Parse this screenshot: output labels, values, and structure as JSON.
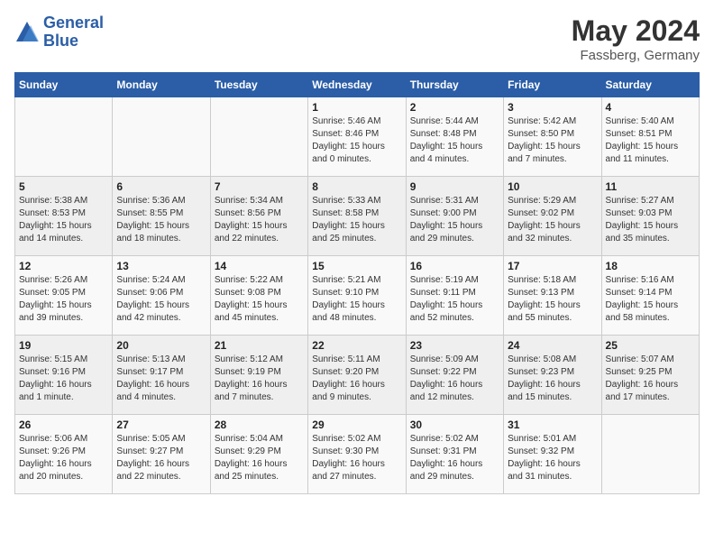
{
  "header": {
    "logo_line1": "General",
    "logo_line2": "Blue",
    "month_year": "May 2024",
    "location": "Fassberg, Germany"
  },
  "days_of_week": [
    "Sunday",
    "Monday",
    "Tuesday",
    "Wednesday",
    "Thursday",
    "Friday",
    "Saturday"
  ],
  "weeks": [
    [
      {
        "day": "",
        "info": ""
      },
      {
        "day": "",
        "info": ""
      },
      {
        "day": "",
        "info": ""
      },
      {
        "day": "1",
        "info": "Sunrise: 5:46 AM\nSunset: 8:46 PM\nDaylight: 15 hours\nand 0 minutes."
      },
      {
        "day": "2",
        "info": "Sunrise: 5:44 AM\nSunset: 8:48 PM\nDaylight: 15 hours\nand 4 minutes."
      },
      {
        "day": "3",
        "info": "Sunrise: 5:42 AM\nSunset: 8:50 PM\nDaylight: 15 hours\nand 7 minutes."
      },
      {
        "day": "4",
        "info": "Sunrise: 5:40 AM\nSunset: 8:51 PM\nDaylight: 15 hours\nand 11 minutes."
      }
    ],
    [
      {
        "day": "5",
        "info": "Sunrise: 5:38 AM\nSunset: 8:53 PM\nDaylight: 15 hours\nand 14 minutes."
      },
      {
        "day": "6",
        "info": "Sunrise: 5:36 AM\nSunset: 8:55 PM\nDaylight: 15 hours\nand 18 minutes."
      },
      {
        "day": "7",
        "info": "Sunrise: 5:34 AM\nSunset: 8:56 PM\nDaylight: 15 hours\nand 22 minutes."
      },
      {
        "day": "8",
        "info": "Sunrise: 5:33 AM\nSunset: 8:58 PM\nDaylight: 15 hours\nand 25 minutes."
      },
      {
        "day": "9",
        "info": "Sunrise: 5:31 AM\nSunset: 9:00 PM\nDaylight: 15 hours\nand 29 minutes."
      },
      {
        "day": "10",
        "info": "Sunrise: 5:29 AM\nSunset: 9:02 PM\nDaylight: 15 hours\nand 32 minutes."
      },
      {
        "day": "11",
        "info": "Sunrise: 5:27 AM\nSunset: 9:03 PM\nDaylight: 15 hours\nand 35 minutes."
      }
    ],
    [
      {
        "day": "12",
        "info": "Sunrise: 5:26 AM\nSunset: 9:05 PM\nDaylight: 15 hours\nand 39 minutes."
      },
      {
        "day": "13",
        "info": "Sunrise: 5:24 AM\nSunset: 9:06 PM\nDaylight: 15 hours\nand 42 minutes."
      },
      {
        "day": "14",
        "info": "Sunrise: 5:22 AM\nSunset: 9:08 PM\nDaylight: 15 hours\nand 45 minutes."
      },
      {
        "day": "15",
        "info": "Sunrise: 5:21 AM\nSunset: 9:10 PM\nDaylight: 15 hours\nand 48 minutes."
      },
      {
        "day": "16",
        "info": "Sunrise: 5:19 AM\nSunset: 9:11 PM\nDaylight: 15 hours\nand 52 minutes."
      },
      {
        "day": "17",
        "info": "Sunrise: 5:18 AM\nSunset: 9:13 PM\nDaylight: 15 hours\nand 55 minutes."
      },
      {
        "day": "18",
        "info": "Sunrise: 5:16 AM\nSunset: 9:14 PM\nDaylight: 15 hours\nand 58 minutes."
      }
    ],
    [
      {
        "day": "19",
        "info": "Sunrise: 5:15 AM\nSunset: 9:16 PM\nDaylight: 16 hours\nand 1 minute."
      },
      {
        "day": "20",
        "info": "Sunrise: 5:13 AM\nSunset: 9:17 PM\nDaylight: 16 hours\nand 4 minutes."
      },
      {
        "day": "21",
        "info": "Sunrise: 5:12 AM\nSunset: 9:19 PM\nDaylight: 16 hours\nand 7 minutes."
      },
      {
        "day": "22",
        "info": "Sunrise: 5:11 AM\nSunset: 9:20 PM\nDaylight: 16 hours\nand 9 minutes."
      },
      {
        "day": "23",
        "info": "Sunrise: 5:09 AM\nSunset: 9:22 PM\nDaylight: 16 hours\nand 12 minutes."
      },
      {
        "day": "24",
        "info": "Sunrise: 5:08 AM\nSunset: 9:23 PM\nDaylight: 16 hours\nand 15 minutes."
      },
      {
        "day": "25",
        "info": "Sunrise: 5:07 AM\nSunset: 9:25 PM\nDaylight: 16 hours\nand 17 minutes."
      }
    ],
    [
      {
        "day": "26",
        "info": "Sunrise: 5:06 AM\nSunset: 9:26 PM\nDaylight: 16 hours\nand 20 minutes."
      },
      {
        "day": "27",
        "info": "Sunrise: 5:05 AM\nSunset: 9:27 PM\nDaylight: 16 hours\nand 22 minutes."
      },
      {
        "day": "28",
        "info": "Sunrise: 5:04 AM\nSunset: 9:29 PM\nDaylight: 16 hours\nand 25 minutes."
      },
      {
        "day": "29",
        "info": "Sunrise: 5:02 AM\nSunset: 9:30 PM\nDaylight: 16 hours\nand 27 minutes."
      },
      {
        "day": "30",
        "info": "Sunrise: 5:02 AM\nSunset: 9:31 PM\nDaylight: 16 hours\nand 29 minutes."
      },
      {
        "day": "31",
        "info": "Sunrise: 5:01 AM\nSunset: 9:32 PM\nDaylight: 16 hours\nand 31 minutes."
      },
      {
        "day": "",
        "info": ""
      }
    ]
  ]
}
